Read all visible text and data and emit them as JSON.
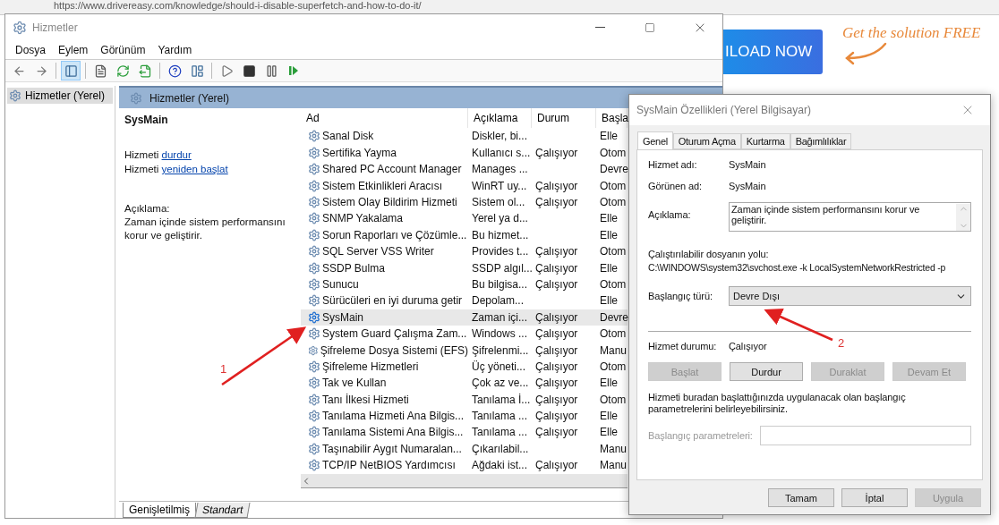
{
  "browser": {
    "url": "https://www.drivereasy.com/knowledge/should-i-disable-superfetch-and-how-to-do-it/",
    "download_button": "ILOAD NOW",
    "promo_text": "Get the solution FREE"
  },
  "services_window": {
    "title": "Hizmetler",
    "menu": [
      "Dosya",
      "Eylem",
      "Görünüm",
      "Yardım"
    ],
    "toolbar": [
      [
        {
          "kind": "back",
          "pressed": false
        },
        {
          "kind": "forward",
          "pressed": false
        }
      ],
      [
        {
          "kind": "console",
          "pressed": true
        }
      ],
      [
        {
          "kind": "properties",
          "pressed": false
        },
        {
          "kind": "refresh",
          "pressed": false
        },
        {
          "kind": "export",
          "pressed": false
        }
      ],
      [
        {
          "kind": "help",
          "pressed": false
        },
        {
          "kind": "view",
          "pressed": false
        }
      ],
      [
        {
          "kind": "play",
          "pressed": false
        },
        {
          "kind": "stop",
          "pressed": false
        },
        {
          "kind": "pause",
          "pressed": false
        },
        {
          "kind": "resume",
          "pressed": false
        }
      ]
    ],
    "tree": [
      {
        "label": "Hizmetler (Yerel)",
        "selected": true
      }
    ],
    "header": "Hizmetler (Yerel)",
    "detail": {
      "name": "SysMain",
      "actions": [
        {
          "prefix": "Hizmeti",
          "link": "durdur"
        },
        {
          "prefix": "Hizmeti",
          "link": "yeniden başlat"
        }
      ],
      "description_label": "Açıklama:",
      "description": "Zaman içinde sistem performansını korur ve geliştirir."
    },
    "table": {
      "columns": [
        "Ad",
        "Açıklama",
        "Durum",
        "Başla"
      ],
      "rows": [
        {
          "name": "Sanal Disk",
          "description": "Diskler, bi...",
          "startup": "Elle",
          "selected": false
        },
        {
          "name": "Sertifika Yayma",
          "description": "Kullanıcı s...",
          "status": "Çalışıyor",
          "startup": "Otom",
          "selected": false
        },
        {
          "name": "Shared PC Account Manager",
          "description": "Manages ...",
          "startup": "Devre",
          "selected": false
        },
        {
          "name": "Sistem Etkinlikleri Aracısı",
          "description": "WinRT uy...",
          "status": "Çalışıyor",
          "startup": "Otom",
          "selected": false
        },
        {
          "name": "Sistem Olay Bildirim Hizmeti",
          "description": "Sistem ol...",
          "status": "Çalışıyor",
          "startup": "Otom",
          "selected": false
        },
        {
          "name": "SNMP Yakalama",
          "description": "Yerel ya d...",
          "startup": "Elle",
          "selected": false
        },
        {
          "name": "Sorun Raporları ve Çözümle...",
          "description": "Bu hizmet...",
          "startup": "Elle",
          "selected": false
        },
        {
          "name": "SQL Server VSS Writer",
          "description": "Provides t...",
          "status": "Çalışıyor",
          "startup": "Otom",
          "selected": false
        },
        {
          "name": "SSDP Bulma",
          "description": "SSDP algıl...",
          "status": "Çalışıyor",
          "startup": "Elle",
          "selected": false
        },
        {
          "name": "Sunucu",
          "description": "Bu bilgisa...",
          "status": "Çalışıyor",
          "startup": "Otom",
          "selected": false
        },
        {
          "name": "Sürücüleri en iyi duruma getir",
          "description": "Depolam...",
          "startup": "Elle",
          "selected": false
        },
        {
          "name": "SysMain",
          "description": "Zaman içi...",
          "status": "Çalışıyor",
          "startup": "Devre",
          "selected": true
        },
        {
          "name": "System Guard Çalışma Zam...",
          "description": "Windows ...",
          "status": "Çalışıyor",
          "startup": "Otom",
          "selected": false
        },
        {
          "name": "Şifreleme Dosya Sistemi (EFS)",
          "description": "Şifrelenmi...",
          "status": "Çalışıyor",
          "startup": "Manu",
          "selected": false
        },
        {
          "name": "Şifreleme Hizmetleri",
          "description": "Üç yöneti...",
          "status": "Çalışıyor",
          "startup": "Otom",
          "selected": false
        },
        {
          "name": "Tak ve Kullan",
          "description": "Çok az ve...",
          "status": "Çalışıyor",
          "startup": "Elle",
          "selected": false
        },
        {
          "name": "Tanı İlkesi Hizmeti",
          "description": "Tanılama İ...",
          "status": "Çalışıyor",
          "startup": "Otom",
          "selected": false
        },
        {
          "name": "Tanılama Hizmeti Ana Bilgis...",
          "description": "Tanılama ...",
          "status": "Çalışıyor",
          "startup": "Elle",
          "selected": false
        },
        {
          "name": "Tanılama Sistemi Ana Bilgis...",
          "description": "Tanılama ...",
          "status": "Çalışıyor",
          "startup": "Elle",
          "selected": false
        },
        {
          "name": "Taşınabilir Aygıt Numaralan...",
          "description": "Çıkarılabil...",
          "startup": "Manu",
          "selected": false
        },
        {
          "name": "TCP/IP NetBIOS Yardımcısı",
          "description": "Ağdaki ist...",
          "status": "Çalışıyor",
          "startup": "Manu",
          "selected": false
        }
      ]
    },
    "view_tabs": [
      {
        "label": "Genişletilmiş",
        "selected": true
      },
      {
        "label": "Standart",
        "selected": false
      }
    ]
  },
  "dialog": {
    "title": "SysMain Özellikleri (Yerel Bilgisayar)",
    "tabs": [
      {
        "label": "Genel",
        "selected": true
      },
      {
        "label": "Oturum Açma",
        "selected": false
      },
      {
        "label": "Kurtarma",
        "selected": false
      },
      {
        "label": "Bağımlılıklar",
        "selected": false
      }
    ],
    "fields": [
      {
        "label": "Hizmet adı:",
        "value": "SysMain"
      },
      {
        "label": "Görünen ad:",
        "value": "SysMain"
      }
    ],
    "description": {
      "label": "Açıklama:",
      "value": "Zaman içinde sistem performansını korur ve geliştirir."
    },
    "path": {
      "label": "Çalıştırılabilir dosyanın yolu:",
      "value": "C:\\WINDOWS\\system32\\svchost.exe -k LocalSystemNetworkRestricted -p"
    },
    "startup": {
      "label": "Başlangıç türü:",
      "value": "Devre Dışı"
    },
    "status": {
      "label": "Hizmet durumu:",
      "value": "Çalışıyor"
    },
    "service_buttons": [
      {
        "label": "Başlat",
        "disabled": true
      },
      {
        "label": "Durdur",
        "disabled": false
      },
      {
        "label": "Duraklat",
        "disabled": true
      },
      {
        "label": "Devam Et",
        "disabled": true
      }
    ],
    "hint": "Hizmeti buradan başlattığınızda uygulanacak olan başlangıç parametrelerini belirleyebilirsiniz.",
    "parameters": {
      "label": "Başlangıç parametreleri:",
      "disabled": true
    },
    "buttons": [
      {
        "label": "Tamam",
        "disabled": false
      },
      {
        "label": "İptal",
        "disabled": false
      },
      {
        "label": "Uygula",
        "disabled": true
      }
    ]
  },
  "annotations": [
    {
      "label": "1"
    },
    {
      "label": "2"
    }
  ]
}
